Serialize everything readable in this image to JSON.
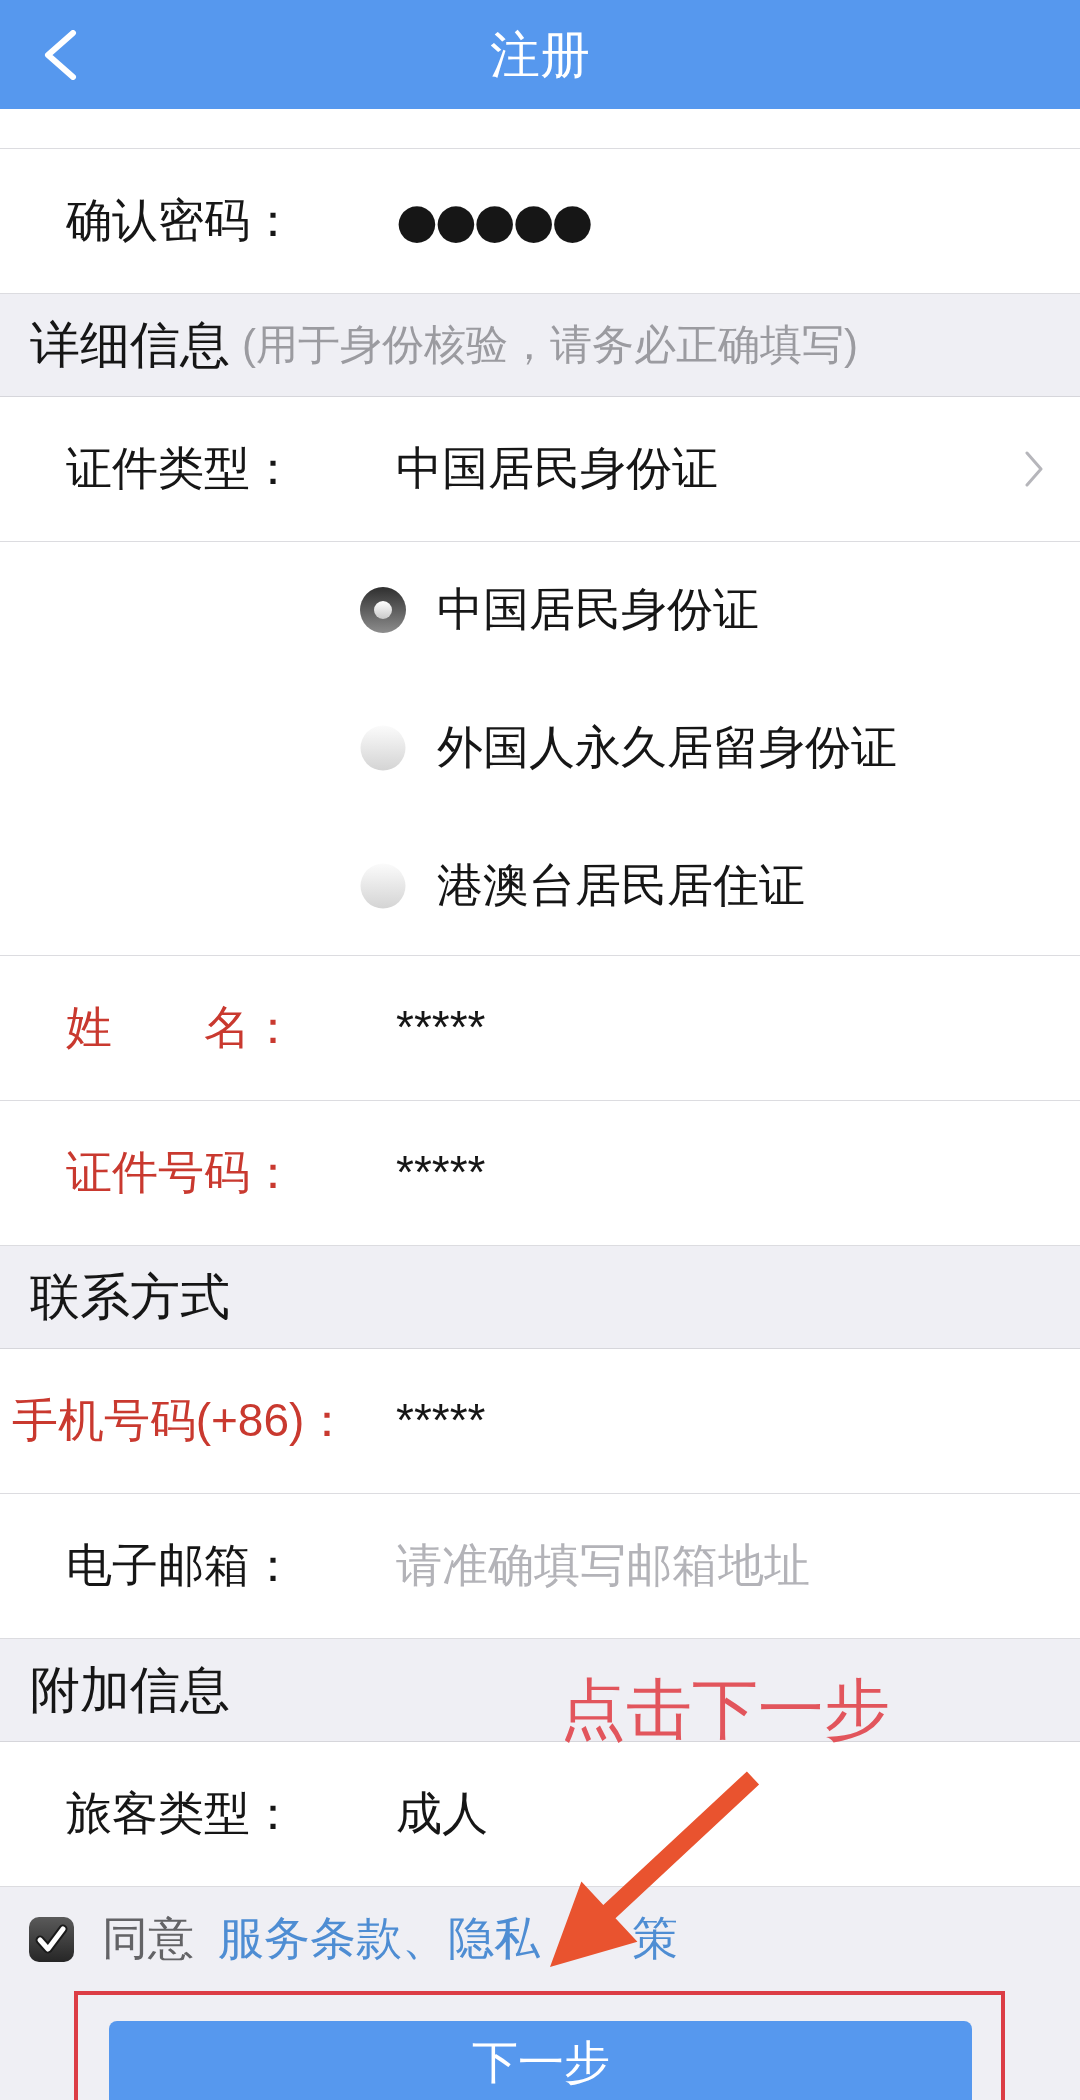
{
  "nav_bar": {
    "title": "注册"
  },
  "form": [
    {
      "kind": "password",
      "label": "确认密码：",
      "value": "●●●●●",
      "required": false
    },
    {
      "kind": "section",
      "title": "详细信息",
      "note": "(用于身份核验，请务必正确填写)"
    },
    {
      "kind": "select",
      "label": "证件类型：",
      "value": "中国居民身份证",
      "required": false
    },
    {
      "kind": "radio_group",
      "options": [
        {
          "label": "中国居民身份证",
          "selected": true
        },
        {
          "label": "外国人永久居留身份证",
          "selected": false
        },
        {
          "label": "港澳台居民居住证",
          "selected": false
        }
      ]
    },
    {
      "kind": "field",
      "label": "姓　　名：",
      "value": "*****",
      "required": true
    },
    {
      "kind": "field",
      "label": "证件号码：",
      "value": "*****",
      "required": true
    },
    {
      "kind": "section",
      "title": "联系方式"
    },
    {
      "kind": "field",
      "label": "手机号码(+86)：",
      "value": "*****",
      "required": true
    },
    {
      "kind": "field",
      "label": "电子邮箱：",
      "placeholder": "请准确填写邮箱地址",
      "required": false
    },
    {
      "kind": "section",
      "title": "附加信息"
    },
    {
      "kind": "field",
      "label": "旅客类型：",
      "value": "成人",
      "required": false
    }
  ],
  "agreement": {
    "checked": true,
    "label": "同意",
    "link_parts": [
      "服务条款、隐私",
      "策"
    ]
  },
  "next_button": {
    "label": "下一步"
  },
  "annotation": {
    "text": "点击下一步"
  }
}
